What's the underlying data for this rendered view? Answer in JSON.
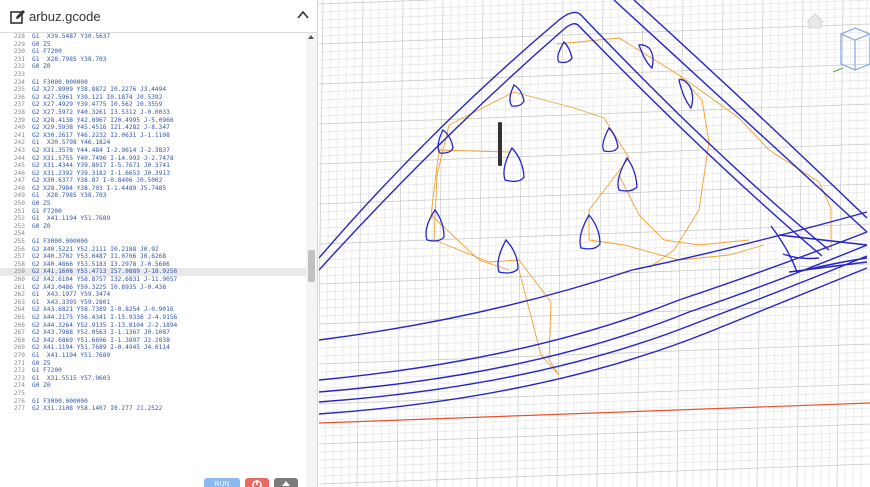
{
  "editor": {
    "filename": "arbuz.gcode",
    "highlighted_line": 259,
    "lines": [
      {
        "n": 228,
        "t": "G1  X39.5487 Y30.5637"
      },
      {
        "n": 229,
        "t": "G0 Z5"
      },
      {
        "n": 230,
        "t": "G1 F7200"
      },
      {
        "n": 231,
        "t": "G1  X28.7985 Y38.703"
      },
      {
        "n": 232,
        "t": "G0 Z0"
      },
      {
        "n": 233,
        "t": ""
      },
      {
        "n": 234,
        "t": "G1 F3000.000000"
      },
      {
        "n": 235,
        "t": "G2 X27.8909 Y38.8872 I0.2276 J3.4494"
      },
      {
        "n": 236,
        "t": "G2 X27.5961 Y39.121 I0.1874 J0.5392"
      },
      {
        "n": 237,
        "t": "G2 X27.4929 Y39.4775 I0.562 J0.3559"
      },
      {
        "n": 238,
        "t": "G2 X27.5972 Y40.3261 I3.5312 J-0.0033"
      },
      {
        "n": 239,
        "t": "G2 X28.4138 Y42.8967 I20.4995 J-5.0966"
      },
      {
        "n": 240,
        "t": "G2 X29.5938 Y45.4516 I21.4282 J-8.347"
      },
      {
        "n": 241,
        "t": "G2 X30.2617 Y46.2232 I2.0631 J-1.1108"
      },
      {
        "n": 242,
        "t": "G1  X30.5798 Y46.1824"
      },
      {
        "n": 243,
        "t": "G2 X31.3578 Y44.484 I-2.9614 J-2.3837"
      },
      {
        "n": 244,
        "t": "G2 X31.5755 Y40.7496 I-14.993 J-2.7478"
      },
      {
        "n": 245,
        "t": "G2 X31.4344 Y39.8017 I-5.7671 J0.3741"
      },
      {
        "n": 246,
        "t": "G2 X31.2392 Y39.3182 I-1.6653 J0.3913"
      },
      {
        "n": 247,
        "t": "G2 X30.6377 Y38.87 I-0.8406 J0.5002"
      },
      {
        "n": 248,
        "t": "G2 X28.7984 Y38.703 I-1.4489 J5.7485"
      },
      {
        "n": 249,
        "t": "G1  X28.7985 Y38.703"
      },
      {
        "n": 250,
        "t": "G0 Z5"
      },
      {
        "n": 251,
        "t": "G1 F7200"
      },
      {
        "n": 252,
        "t": "G1  X41.1194 Y51.7689"
      },
      {
        "n": 253,
        "t": "G0 Z0"
      },
      {
        "n": 254,
        "t": ""
      },
      {
        "n": 255,
        "t": "G1 F3000.000000"
      },
      {
        "n": 256,
        "t": "G2 X40.5221 Y52.2111 I0.2188 J0.92"
      },
      {
        "n": 257,
        "t": "G2 X40.3702 Y53.0487 I1.0706 J0.6268"
      },
      {
        "n": 258,
        "t": "G2 X40.4866 Y53.5183 I3.2978 J-0.5686"
      },
      {
        "n": 259,
        "t": "G2 X41.1608 Y55.4713 I57.9889 J-18.9256"
      },
      {
        "n": 260,
        "t": "G2 X42.6104 Y58.8757 I32.6831 J-11.9057"
      },
      {
        "n": 261,
        "t": "G2 X43.0486 Y59.3225 I0.8935 J-0.438"
      },
      {
        "n": 262,
        "t": "G1  X43.1977 Y59.3474"
      },
      {
        "n": 263,
        "t": "G1  X43.3395 Y59.2801"
      },
      {
        "n": 264,
        "t": "G2 X43.6821 Y58.7389 I-0.8254 J-0.9016"
      },
      {
        "n": 265,
        "t": "G2 X44.2175 Y56.4341 I-15.9336 J-4.9156"
      },
      {
        "n": 266,
        "t": "G2 X44.3264 Y52.9135 I-13.8104 J-2.1894"
      },
      {
        "n": 267,
        "t": "G2 X43.7988 Y52.0563 I-1.1367 J0.1087"
      },
      {
        "n": 268,
        "t": "G2 X42.6869 Y51.6696 I-1.3897 J2.2038"
      },
      {
        "n": 269,
        "t": "G2 X41.1194 Y51.7689 I-0.4945 J4.6114"
      },
      {
        "n": 270,
        "t": "G1  X41.1194 Y51.7689"
      },
      {
        "n": 271,
        "t": "G0 Z5"
      },
      {
        "n": 272,
        "t": "G1 F7200"
      },
      {
        "n": 273,
        "t": "G1  X31.5515 Y57.9603"
      },
      {
        "n": 274,
        "t": "G0 Z0"
      },
      {
        "n": 275,
        "t": ""
      },
      {
        "n": 276,
        "t": "G1 F3000.000000"
      },
      {
        "n": 277,
        "t": "G2 X31.1108 Y58.1407 I0.277 J1.2522"
      }
    ],
    "buttons": {
      "run_label": "RUN",
      "stop_icon": "stop-icon",
      "upload_icon": "upload-icon"
    }
  },
  "colors": {
    "toolpath": "#2424c8",
    "travel": "#f0a030",
    "grid_minor": "#e6e6e6",
    "grid_major": "#c6c6c6",
    "x_axis": "#e8502c",
    "tool": "#333333",
    "code_text": "#3357aa",
    "line_number": "#8a8a8a",
    "run_button": "#8ab9f0",
    "stop_button": "#e96a60",
    "upload_button": "#7a7a7a"
  },
  "viewport": {
    "home_icon": "home-icon",
    "view_cube_icon": "view-cube-icon"
  }
}
